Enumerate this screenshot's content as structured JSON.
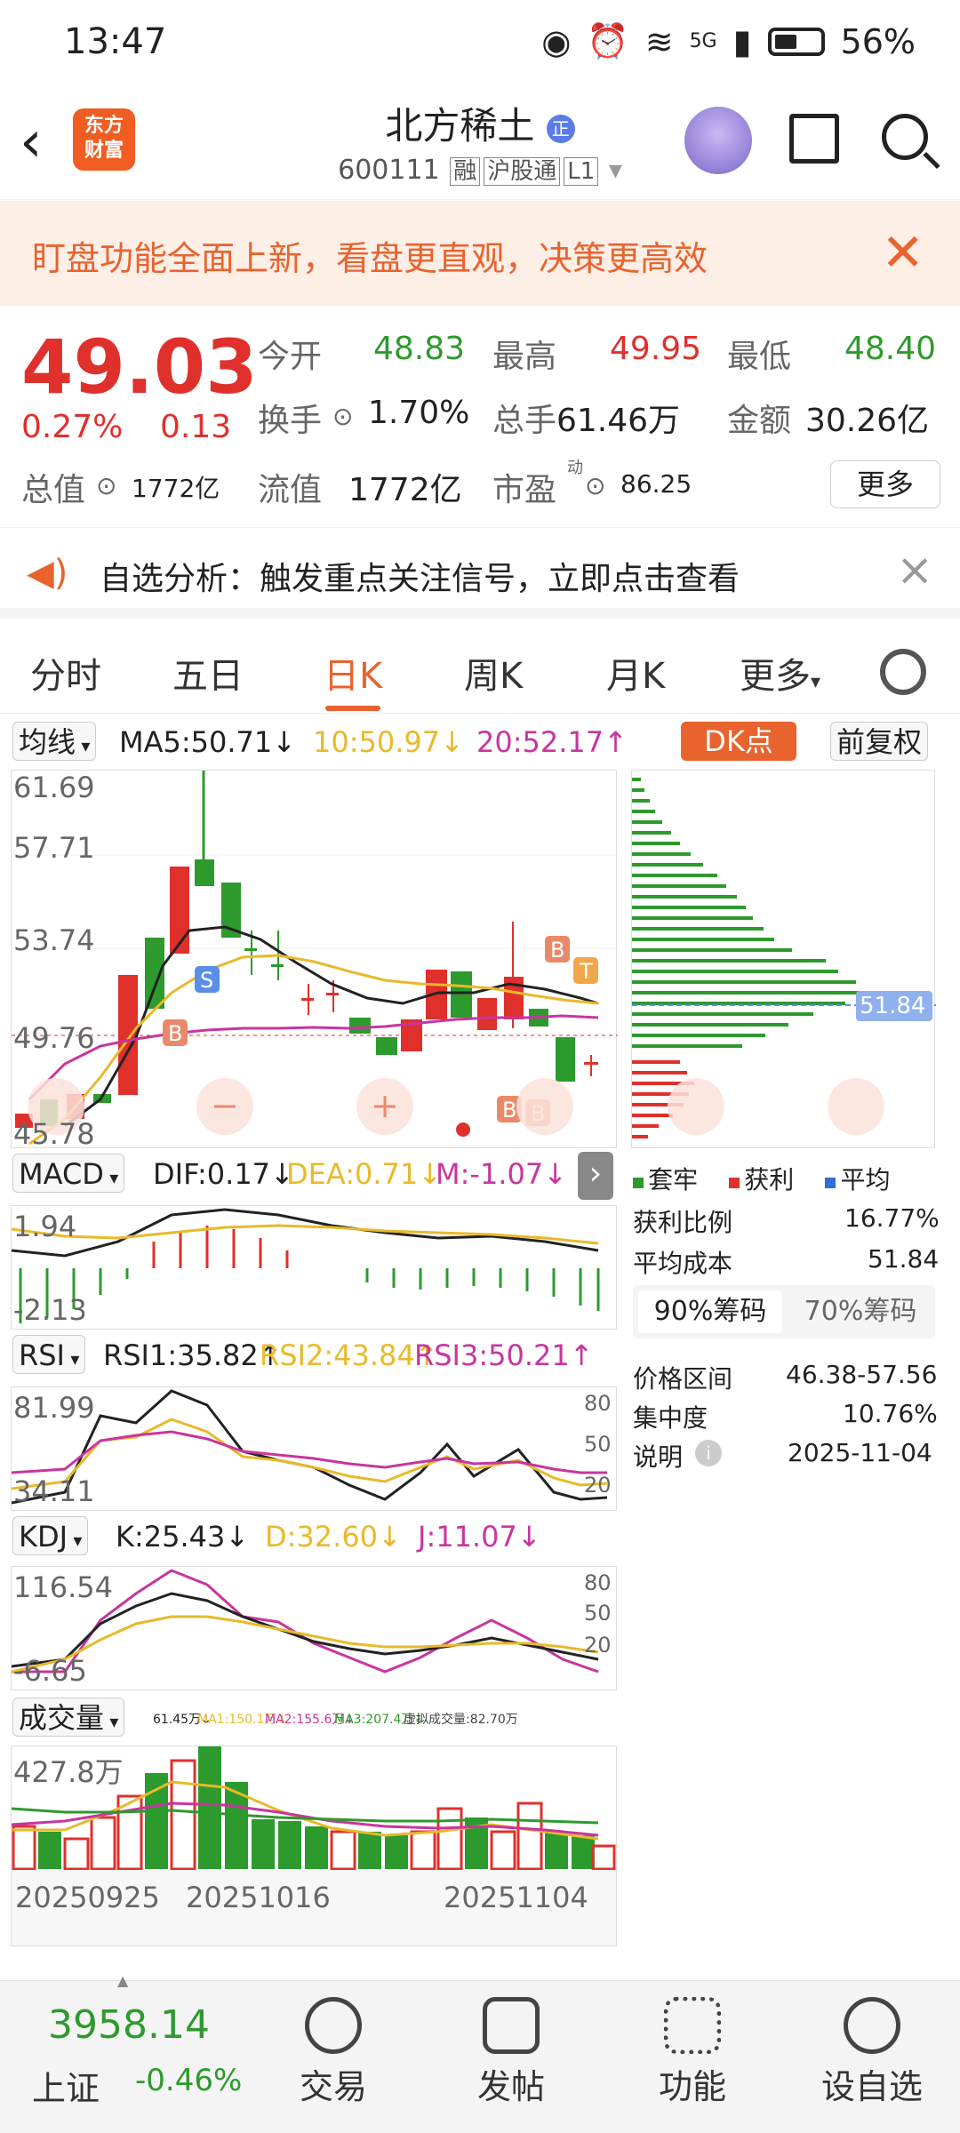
{
  "status_bar": {
    "time": "13:47",
    "network": "5G",
    "battery": "56%"
  },
  "header": {
    "title": "北方稀土",
    "badge": "正",
    "code": "600111",
    "tags": [
      "融",
      "沪股通",
      "L1"
    ],
    "logo": [
      "东方",
      "财富"
    ]
  },
  "banner": {
    "text": "盯盘功能全面上新，看盘更直观，决策更高效"
  },
  "quote": {
    "price": "49.03",
    "change_pct": "0.27%",
    "change": "0.13",
    "open_label": "今开",
    "open": "48.83",
    "high_label": "最高",
    "high": "49.95",
    "low_label": "最低",
    "low": "48.40",
    "turnover_label": "换手",
    "turnover": "1.70%",
    "volume_label": "总手",
    "volume": "61.46万",
    "amount_label": "金额",
    "amount": "30.26亿",
    "mcap_label": "总值",
    "mcap": "1772亿",
    "float_label": "流值",
    "float": "1772亿",
    "pe_label": "市盈",
    "pe_sup": "动",
    "pe": "86.25",
    "more": "更多"
  },
  "notice": {
    "text": "自选分析：触发重点关注信号，立即点击查看"
  },
  "tabs": [
    "分时",
    "五日",
    "日K",
    "周K",
    "月K",
    "更多"
  ],
  "active_tab": "日K",
  "kline": {
    "ma_selector": "均线",
    "ma5": "MA5:50.71↓",
    "ma10": "10:50.97↓",
    "ma20": "20:52.17↑",
    "dk_button": "DK点",
    "adjust_button": "前复权",
    "y_labels": [
      "61.69",
      "57.71",
      "53.74",
      "49.76",
      "45.78"
    ],
    "chips_price": "51.84"
  },
  "chips": {
    "legend": [
      "套牢",
      "获利",
      "平均"
    ],
    "profit_ratio_label": "获利比例",
    "profit_ratio": "16.77%",
    "avg_cost_label": "平均成本",
    "avg_cost": "51.84",
    "tab_90": "90%筹码",
    "tab_70": "70%筹码",
    "range_label": "价格区间",
    "range": "46.38-57.56",
    "concentration_label": "集中度",
    "concentration": "10.76%",
    "note_label": "说明",
    "note_date": "2025-11-04"
  },
  "macd": {
    "selector": "MACD",
    "dif": "DIF:0.17↓",
    "dea": "DEA:0.71↓",
    "m": "M:-1.07↓",
    "y_top": "1.94",
    "y_bottom": "-2.13"
  },
  "rsi": {
    "selector": "RSI",
    "rsi1": "RSI1:35.82↑",
    "rsi2": "RSI2:43.84↑",
    "rsi3": "RSI3:50.21↑",
    "y_top": "81.99",
    "y_bottom": "34.11",
    "levels": [
      "80",
      "50",
      "20"
    ]
  },
  "kdj": {
    "selector": "KDJ",
    "k": "K:25.43↓",
    "d": "D:32.60↓",
    "j": "J:11.07↓",
    "y_top": "116.54",
    "y_bottom": "-6.65",
    "levels": [
      "80",
      "50",
      "20"
    ]
  },
  "volume": {
    "selector": "成交量",
    "info": [
      "61.45万↓",
      "MA1:150.1万↓",
      "MA2:155.6万↓",
      "MA3:207.4万↓",
      "虚拟成交量:82.70万"
    ],
    "y_top": "427.8万",
    "dates": [
      "20250925",
      "20251016",
      "20251104"
    ]
  },
  "bottom_bar": {
    "index_value": "3958.14",
    "index_name": "上证",
    "index_change": "-0.46%",
    "items": [
      "交易",
      "发帖",
      "功能",
      "设自选"
    ]
  },
  "colors": {
    "up": "#e0302c",
    "down": "#2d9a2d",
    "accent": "#e8632e",
    "ma10": "#e8b92b",
    "ma20": "#c8359e"
  }
}
